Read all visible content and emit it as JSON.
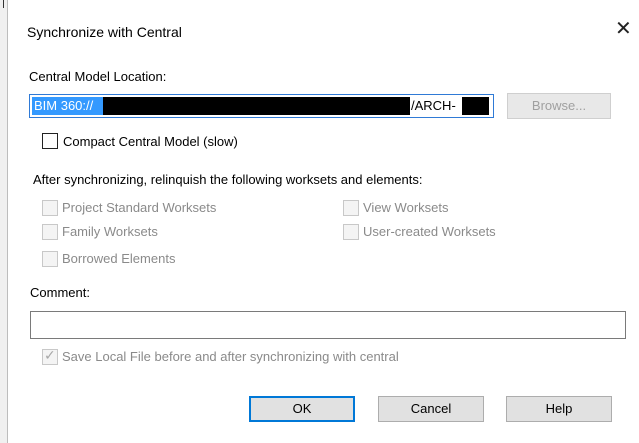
{
  "dialog": {
    "title": "Synchronize with Central",
    "close_glyph": "✕"
  },
  "location": {
    "label": "Central Model Location:",
    "prefix_text": "BIM 360://",
    "suffix_text": "/ARCH-",
    "browse_label": "Browse..."
  },
  "compact": {
    "label": "Compact Central Model (slow)",
    "checked": false
  },
  "relinquish": {
    "heading": "After synchronizing, relinquish the following worksets and elements:",
    "options": [
      {
        "label": "Project Standard Worksets",
        "checked": false,
        "enabled": false
      },
      {
        "label": "View Worksets",
        "checked": false,
        "enabled": false
      },
      {
        "label": "Family Worksets",
        "checked": false,
        "enabled": false
      },
      {
        "label": "User-created Worksets",
        "checked": false,
        "enabled": false
      },
      {
        "label": "Borrowed Elements",
        "checked": false,
        "enabled": false
      }
    ]
  },
  "comment": {
    "label": "Comment:",
    "value": ""
  },
  "save_local": {
    "label": "Save Local File before and after synchronizing with central",
    "checked": true,
    "enabled": false
  },
  "buttons": {
    "ok": "OK",
    "cancel": "Cancel",
    "help": "Help"
  }
}
